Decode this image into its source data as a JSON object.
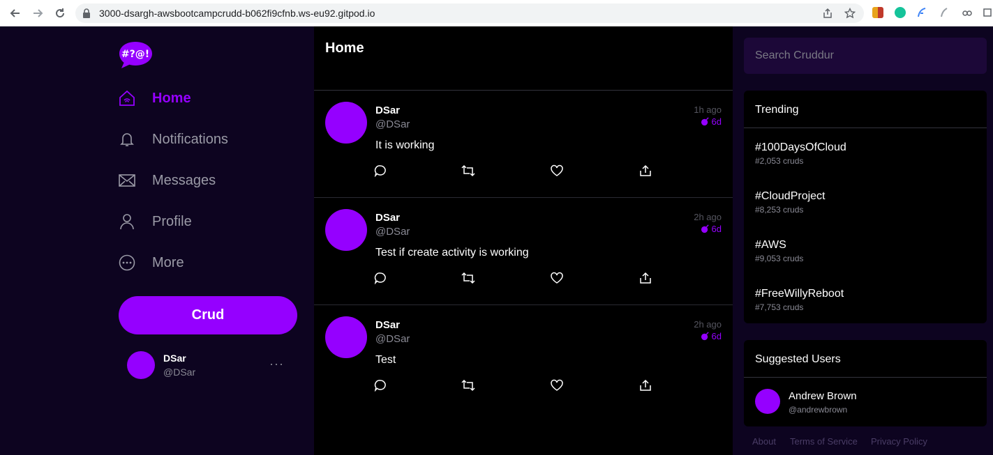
{
  "browser": {
    "url": "3000-dsargh-awsbootcampcrudd-b062fi9cfnb.ws-eu92.gitpod.io"
  },
  "colors": {
    "accent": "#9500ff",
    "sidebar_bg": "#0d0420",
    "feed_bg": "#000000",
    "muted": "#8a8a95"
  },
  "logo": {
    "text": "#?@!"
  },
  "menu": [
    {
      "label": "Home",
      "icon": "home-icon",
      "active": true
    },
    {
      "label": "Notifications",
      "icon": "bell-icon",
      "active": false
    },
    {
      "label": "Messages",
      "icon": "envelope-icon",
      "active": false
    },
    {
      "label": "Profile",
      "icon": "user-icon",
      "active": false
    },
    {
      "label": "More",
      "icon": "ellipsis-circle-icon",
      "active": false
    }
  ],
  "crud_button": "Crud",
  "profile": {
    "name": "DSar",
    "handle": "@DSar",
    "more": "···"
  },
  "feed": {
    "title": "Home",
    "activities": [
      {
        "name": "DSar",
        "handle": "@DSar",
        "message": "It is working",
        "time": "1h ago",
        "expires": "6d"
      },
      {
        "name": "DSar",
        "handle": "@DSar",
        "message": "Test if create activity is working",
        "time": "2h ago",
        "expires": "6d"
      },
      {
        "name": "DSar",
        "handle": "@DSar",
        "message": "Test",
        "time": "2h ago",
        "expires": "6d"
      }
    ]
  },
  "search": {
    "placeholder": "Search Cruddur"
  },
  "trending": {
    "title": "Trending",
    "items": [
      {
        "tag": "#100DaysOfCloud",
        "count": "#2,053 cruds"
      },
      {
        "tag": "#CloudProject",
        "count": "#8,253 cruds"
      },
      {
        "tag": "#AWS",
        "count": "#9,053 cruds"
      },
      {
        "tag": "#FreeWillyReboot",
        "count": "#7,753 cruds"
      }
    ]
  },
  "suggested": {
    "title": "Suggested Users",
    "users": [
      {
        "name": "Andrew Brown",
        "handle": "@andrewbrown"
      }
    ]
  },
  "footer": [
    "About",
    "Terms of Service",
    "Privacy Policy"
  ]
}
